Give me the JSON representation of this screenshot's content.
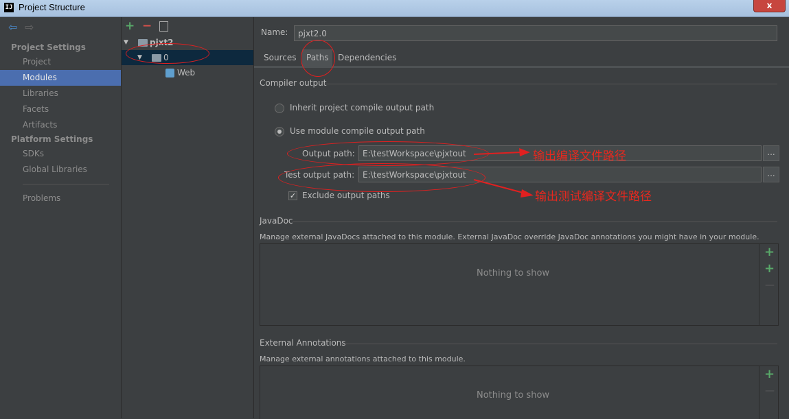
{
  "window": {
    "title": "Project Structure",
    "icon_text": "IJ",
    "close_glyph": "x"
  },
  "nav": {
    "back_glyph": "⇦",
    "forward_glyph": "⇨",
    "sections": [
      {
        "title": "Project Settings",
        "items": [
          "Project",
          "Modules",
          "Libraries",
          "Facets",
          "Artifacts"
        ]
      },
      {
        "title": "Platform Settings",
        "items": [
          "SDKs",
          "Global Libraries"
        ]
      }
    ],
    "selected_item": "Modules",
    "extra_item": "Problems"
  },
  "tree": {
    "toolbar": {
      "add": "+",
      "remove": "−"
    },
    "nodes": [
      {
        "label": "pjxt2",
        "level": 0,
        "expanded": true
      },
      {
        "label": "0",
        "level": 1,
        "expanded": true,
        "selected": true
      },
      {
        "label": "Web",
        "level": 2
      }
    ]
  },
  "module": {
    "name_label": "Name:",
    "name_value": "pjxt2.0",
    "tabs": [
      "Sources",
      "Paths",
      "Dependencies"
    ],
    "active_tab": "Paths"
  },
  "compiler_output": {
    "title": "Compiler output",
    "option_inherit": "Inherit project compile output path",
    "option_module": "Use module compile output path",
    "selected_option": "module",
    "output_label": "Output path:",
    "output_value": "E:\\testWorkspace\\pjxtout",
    "test_label": "Test output path:",
    "test_value": "E:\\testWorkspace\\pjxtout",
    "browse_label": "...",
    "exclude_label": "Exclude output paths",
    "exclude_checked": true
  },
  "javadoc": {
    "title": "JavaDoc",
    "description": "Manage external JavaDocs attached to this module. External JavaDoc override JavaDoc annotations you might have in your module.",
    "empty_text": "Nothing to show"
  },
  "external_annotations": {
    "title": "External Annotations",
    "description": "Manage external annotations attached to this module.",
    "empty_text": "Nothing to show"
  },
  "annotations": {
    "output_note": "输出编译文件路径",
    "test_note": "输出测试编译文件路径"
  },
  "colors": {
    "background": "#3c3f41",
    "selection": "#4b6eaf",
    "tree_selection": "#0d293e",
    "annotation": "#e8281e",
    "add_icon": "#59a869"
  }
}
